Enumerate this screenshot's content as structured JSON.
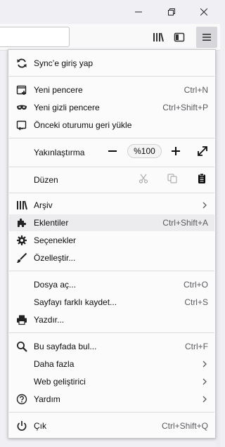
{
  "window": {
    "controls": [
      "minimize-icon",
      "restore-icon",
      "close-icon"
    ]
  },
  "toolbar": {
    "icons": [
      "library-icon",
      "sidebar-icon",
      "hamburger-menu-icon"
    ]
  },
  "menu": {
    "sync": {
      "label": "Sync’e giriş yap",
      "icon": "sync-icon"
    },
    "new_window": {
      "label": "Yeni pencere",
      "shortcut": "Ctrl+N",
      "icon": "new-window-icon"
    },
    "private_window": {
      "label": "Yeni gizli pencere",
      "shortcut": "Ctrl+Shift+P",
      "icon": "private-mask-icon"
    },
    "restore_session": {
      "label": "Önceki oturumu geri yükle",
      "icon": "restore-session-icon"
    },
    "zoom": {
      "label": "Yakınlaştırma",
      "level": "%100",
      "minus": "−",
      "plus": "+"
    },
    "edit": {
      "label": "Düzen",
      "icons": [
        "cut-icon",
        "copy-icon",
        "paste-icon"
      ]
    },
    "library": {
      "label": "Arşiv",
      "icon": "library-icon"
    },
    "addons": {
      "label": "Eklentiler",
      "shortcut": "Ctrl+Shift+A",
      "icon": "puzzle-icon"
    },
    "options": {
      "label": "Seçenekler",
      "icon": "gear-icon"
    },
    "customize": {
      "label": "Özelleştir...",
      "icon": "paintbrush-icon"
    },
    "open_file": {
      "label": "Dosya aç...",
      "shortcut": "Ctrl+O"
    },
    "save_page": {
      "label": "Sayfayı farklı kaydet...",
      "shortcut": "Ctrl+S"
    },
    "print": {
      "label": "Yazdır...",
      "icon": "printer-icon"
    },
    "find": {
      "label": "Bu sayfada bul...",
      "shortcut": "Ctrl+F",
      "icon": "search-icon"
    },
    "more": {
      "label": "Daha fazla"
    },
    "web_dev": {
      "label": "Web geliştirici"
    },
    "help": {
      "label": "Yardım",
      "icon": "help-icon"
    },
    "quit": {
      "label": "Çık",
      "shortcut": "Ctrl+Shift+Q",
      "icon": "power-icon"
    }
  },
  "colors": {
    "panel_bg": "#fbfbfb",
    "highlight": "#ececee",
    "separator": "#dcdcdf",
    "menu_button_active": "#d7d7db"
  }
}
